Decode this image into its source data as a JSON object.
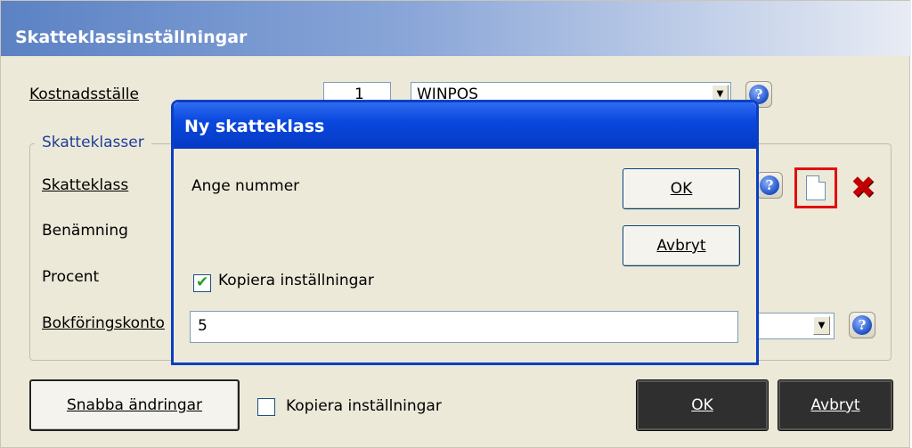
{
  "main": {
    "title": "Skatteklassinställningar",
    "kostnadsstalle_label": "Kostnadsställe",
    "kostnadsstalle_number": "1",
    "kostnadsstalle_name": "WINPOS",
    "group_label": "Skatteklasser",
    "skatteklass_label": "Skatteklass",
    "benamning_label": "Benämning",
    "procent_label": "Procent",
    "bokforingskonto_label": "Bokföringskonto",
    "snabba_button": "Snabba ändringar",
    "kopiera_label": "Kopiera inställningar",
    "kopiera_checked": false,
    "ok_button": "OK",
    "avbryt_button": "Avbryt"
  },
  "dialog": {
    "title": "Ny skatteklass",
    "prompt": "Ange nummer",
    "ok_button": "OK",
    "avbryt_button": "Avbryt",
    "kopiera_label": "Kopiera inställningar",
    "kopiera_checked": true,
    "input_value": "5"
  },
  "icons": {
    "help": "help-icon",
    "new": "new-document-icon",
    "delete": "delete-icon",
    "dropdown": "chevron-down-icon"
  },
  "colors": {
    "dialog_title": "#0a48de",
    "delete": "#c00000",
    "highlight": "#e01010"
  }
}
